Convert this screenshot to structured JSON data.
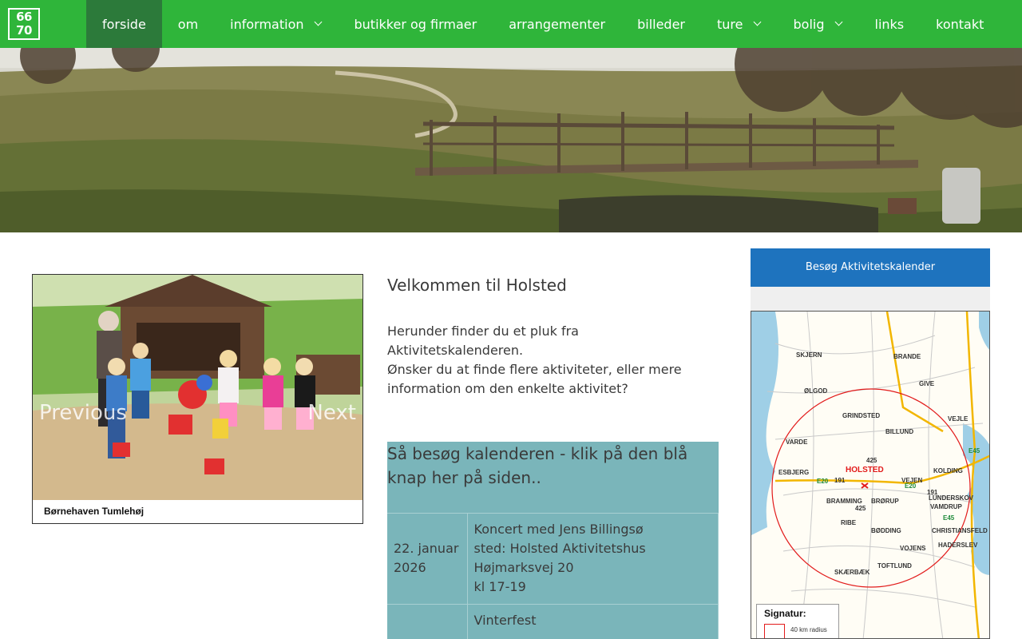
{
  "logo": {
    "line1": "66",
    "line2": "70"
  },
  "nav": {
    "items": [
      {
        "label": "forside",
        "active": true,
        "dropdown": false
      },
      {
        "label": "om",
        "active": false,
        "dropdown": false
      },
      {
        "label": "information",
        "active": false,
        "dropdown": true
      },
      {
        "label": "butikker og firmaer",
        "active": false,
        "dropdown": false
      },
      {
        "label": "arrangementer",
        "active": false,
        "dropdown": false
      },
      {
        "label": "billeder",
        "active": false,
        "dropdown": false
      },
      {
        "label": "ture",
        "active": false,
        "dropdown": true
      },
      {
        "label": "bolig",
        "active": false,
        "dropdown": true
      },
      {
        "label": "links",
        "active": false,
        "dropdown": false
      },
      {
        "label": "kontakt",
        "active": false,
        "dropdown": false
      }
    ]
  },
  "slider": {
    "caption": "Børnehaven Tumlehøj",
    "prev_label": "Previous",
    "next_label": "Next"
  },
  "main": {
    "welcome_title": "Velkommen til Holsted",
    "intro_1": "Herunder finder du et pluk fra Aktivitetskalenderen.",
    "intro_2": "Ønsker du at finde flere aktiviteter, eller mere information om den enkelte aktivitet?",
    "calendar_prompt": "Så besøg kalenderen - klik på den blå knap her på siden..",
    "events": [
      {
        "date": "22. januar 2026",
        "lines": [
          "Koncert med Jens Billingsø",
          "sted: Holsted Aktivitetshus",
          "Højmarksvej 20",
          "kl 17-19"
        ]
      },
      {
        "date": "",
        "lines": [
          "Vinterfest"
        ]
      }
    ]
  },
  "sidebar": {
    "calendar_button": "Besøg Aktivitetskalender",
    "map": {
      "towns": [
        "SKJERN",
        "BRANDE",
        "GIVE",
        "ØLGOD",
        "GRINDSTED",
        "VEJLE",
        "BILLUND",
        "VARDE",
        "ESBJERG",
        "HOLSTED",
        "KOLDING",
        "VEJEN",
        "BRAMMING",
        "BRØRUP",
        "LUNDERSKOV",
        "VAMDRUP",
        "RIBE",
        "BØDDING",
        "CHRISTIANSFELD",
        "HADERSLEV",
        "VOJENS",
        "SKÆRBÆK",
        "TOFTLUND"
      ],
      "roads": [
        "E45",
        "E20",
        "E20",
        "E45",
        "425",
        "191",
        "191",
        "425"
      ],
      "legend_title": "Signatur:",
      "legend_text": "40 km radius"
    }
  }
}
